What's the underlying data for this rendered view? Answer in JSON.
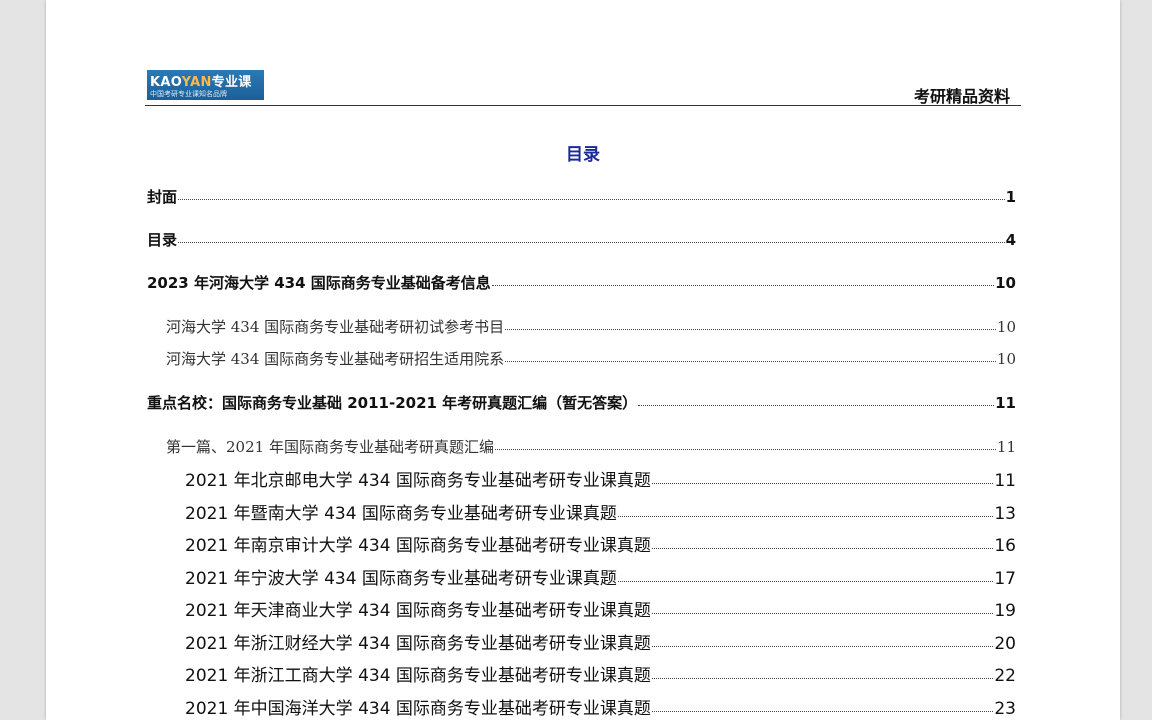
{
  "header": {
    "logo_main_a": "KAO",
    "logo_main_b": "YAN",
    "logo_main_c": "专业课",
    "logo_sub": "中国考研专业课知名品牌",
    "right_text": "考研精品资料"
  },
  "toc": {
    "title": "目录",
    "entries": [
      {
        "label": "封面",
        "page": "1"
      },
      {
        "label": "目录",
        "page": "4"
      },
      {
        "label": "2023 年河海大学 434 国际商务专业基础备考信息",
        "page": "10"
      },
      {
        "label": "河海大学 434 国际商务专业基础考研初试参考书目",
        "page": "10"
      },
      {
        "label": "河海大学 434 国际商务专业基础考研招生适用院系",
        "page": "10"
      },
      {
        "label": "重点名校：国际商务专业基础 2011-2021 年考研真题汇编（暂无答案）",
        "page": "11"
      },
      {
        "label": "第一篇、2021 年国际商务专业基础考研真题汇编",
        "page": "11"
      },
      {
        "label": "2021 年北京邮电大学 434 国际商务专业基础考研专业课真题",
        "page": "11"
      },
      {
        "label": "2021 年暨南大学 434 国际商务专业基础考研专业课真题",
        "page": "13"
      },
      {
        "label": "2021 年南京审计大学 434 国际商务专业基础考研专业课真题",
        "page": "16"
      },
      {
        "label": "2021 年宁波大学 434 国际商务专业基础考研专业课真题",
        "page": "17"
      },
      {
        "label": "2021 年天津商业大学 434 国际商务专业基础考研专业课真题",
        "page": "19"
      },
      {
        "label": "2021 年浙江财经大学 434 国际商务专业基础考研专业课真题",
        "page": "20"
      },
      {
        "label": "2021 年浙江工商大学 434 国际商务专业基础考研专业课真题",
        "page": "22"
      },
      {
        "label": "2021 年中国海洋大学 434 国际商务专业基础考研专业课真题",
        "page": "23"
      }
    ]
  }
}
